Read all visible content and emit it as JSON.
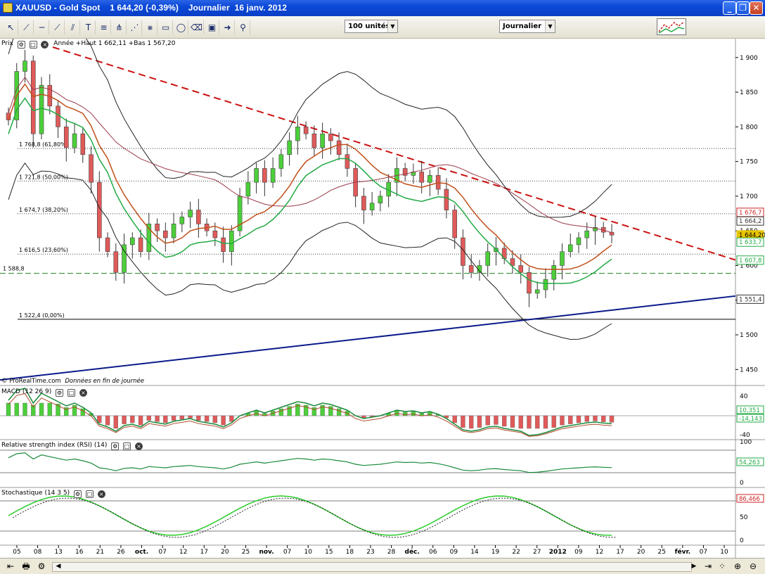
{
  "window": {
    "title": "XAUUSD - Gold Spot    1 644,20 (-0,39%)    Journalier  16 janv. 2012",
    "buttons": {
      "minimize": "_",
      "maximize": "❐",
      "close": "✕"
    }
  },
  "toolbar": {
    "units_combo": "100 unités",
    "period_combo": "Journalier",
    "tools": [
      "cursor-icon",
      "line-icon",
      "hline-icon",
      "trendline-icon",
      "channel-icon",
      "text-icon",
      "fib-icon",
      "pitchfork-icon",
      "fibfan-icon",
      "gann-icon",
      "rect-icon",
      "ellipse-icon",
      "eraser-icon",
      "select-icon",
      "arrow-icon",
      "magnet-icon"
    ]
  },
  "main_panel": {
    "label": "Prix",
    "info": "Année  +Haut 1 662,11 +Bas 1 567,20",
    "copyright": "© ProRealTime.com",
    "copyright_note": "Données en fin de journée",
    "fib_levels": [
      {
        "label": "1 768,8 (61,80%)",
        "value": 1768.8
      },
      {
        "label": "1 721,8 (50,00%)",
        "value": 1721.8
      },
      {
        "label": "1 674,7 (38,20%)",
        "value": 1674.7
      },
      {
        "label": "1 616,5 (23,60%)",
        "value": 1616.5
      },
      {
        "label": "1 522,4 (0,00%)",
        "value": 1522.4
      }
    ],
    "support_label": "1 588,8",
    "price_axis": [
      "1 900",
      "1 850",
      "1 800",
      "1 750",
      "1 700",
      "1 650",
      "1 600",
      "1 550",
      "1 500",
      "1 450"
    ],
    "price_badges": [
      {
        "text": "1 676,7",
        "color": "#cc2222",
        "value": 1676.7
      },
      {
        "text": "1 664,2",
        "color": "#333333",
        "value": 1664.2
      },
      {
        "text": "1 644,20",
        "color": "#e8c400",
        "value": 1644.2
      },
      {
        "text": "1 633,7",
        "color": "#22aa44",
        "value": 1633.7
      },
      {
        "text": "1 607,8",
        "color": "#22aa44",
        "value": 1607.8
      },
      {
        "text": "1 551,4",
        "color": "#333333",
        "value": 1551.4
      }
    ]
  },
  "macd_panel": {
    "label": "MACD (12 26 9)",
    "axis": [
      "40",
      "-40"
    ],
    "badges": [
      {
        "text": "10,351",
        "color": "#22aa44"
      },
      {
        "text": "-14,143",
        "color": "#22aa44"
      }
    ]
  },
  "rsi_panel": {
    "label": "Relative strength index (RSI) (14)",
    "axis": [
      "100",
      "0"
    ],
    "badge": {
      "text": "54,263",
      "color": "#22aa44"
    }
  },
  "stoch_panel": {
    "label": "Stochastique (14 3 5)",
    "axis": [
      "100",
      "50",
      "0"
    ],
    "badge": {
      "text": "86,466",
      "color": "#cc2222"
    }
  },
  "date_axis": [
    {
      "label": "05",
      "bold": false
    },
    {
      "label": "08",
      "bold": false
    },
    {
      "label": "13",
      "bold": false
    },
    {
      "label": "16",
      "bold": false
    },
    {
      "label": "21",
      "bold": false
    },
    {
      "label": "26",
      "bold": false
    },
    {
      "label": "oct.",
      "bold": true
    },
    {
      "label": "07",
      "bold": false
    },
    {
      "label": "12",
      "bold": false
    },
    {
      "label": "17",
      "bold": false
    },
    {
      "label": "20",
      "bold": false
    },
    {
      "label": "25",
      "bold": false
    },
    {
      "label": "nov.",
      "bold": true
    },
    {
      "label": "07",
      "bold": false
    },
    {
      "label": "10",
      "bold": false
    },
    {
      "label": "15",
      "bold": false
    },
    {
      "label": "18",
      "bold": false
    },
    {
      "label": "23",
      "bold": false
    },
    {
      "label": "28",
      "bold": false
    },
    {
      "label": "déc.",
      "bold": true
    },
    {
      "label": "06",
      "bold": false
    },
    {
      "label": "09",
      "bold": false
    },
    {
      "label": "14",
      "bold": false
    },
    {
      "label": "19",
      "bold": false
    },
    {
      "label": "22",
      "bold": false
    },
    {
      "label": "27",
      "bold": false
    },
    {
      "label": "2012",
      "bold": true
    },
    {
      "label": "09",
      "bold": false
    },
    {
      "label": "12",
      "bold": false
    },
    {
      "label": "17",
      "bold": false
    },
    {
      "label": "20",
      "bold": false
    },
    {
      "label": "25",
      "bold": false
    },
    {
      "label": "févr.",
      "bold": true
    },
    {
      "label": "07",
      "bold": false
    },
    {
      "label": "10",
      "bold": false
    }
  ],
  "chart_data": {
    "type": "candlestick",
    "series_closes": [
      1810,
      1880,
      1895,
      1790,
      1860,
      1830,
      1800,
      1770,
      1790,
      1760,
      1720,
      1640,
      1620,
      1590,
      1630,
      1640,
      1620,
      1660,
      1650,
      1640,
      1660,
      1670,
      1680,
      1660,
      1650,
      1640,
      1620,
      1650,
      1700,
      1720,
      1740,
      1720,
      1740,
      1760,
      1780,
      1800,
      1790,
      1770,
      1790,
      1780,
      1760,
      1740,
      1700,
      1680,
      1690,
      1700,
      1720,
      1740,
      1730,
      1735,
      1720,
      1730,
      1710,
      1680,
      1640,
      1600,
      1590,
      1600,
      1620,
      1625,
      1610,
      1600,
      1590,
      1560,
      1565,
      1580,
      1600,
      1620,
      1630,
      1640,
      1650,
      1655,
      1648,
      1644
    ],
    "ylim": [
      1430,
      1915
    ]
  },
  "status": {
    "icons": [
      "back-icon",
      "print-icon",
      "settings-icon",
      "scroll-left-icon",
      "scroll-right-icon",
      "zoom-in-icon",
      "zoom-out-icon",
      "zoom-fit-icon"
    ]
  }
}
